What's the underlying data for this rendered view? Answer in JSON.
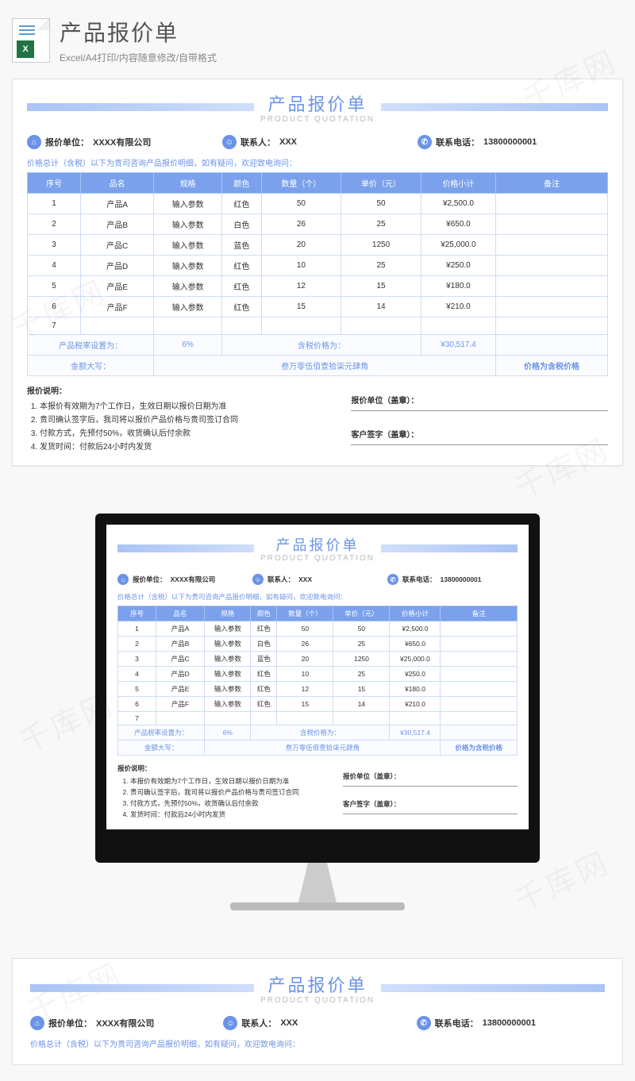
{
  "watermark": "千库网",
  "header": {
    "file_badge": "X",
    "title": "产品报价单",
    "subtitle": "Excel/A4打印/内容随意修改/自带格式"
  },
  "quotation": {
    "title": "产品报价单",
    "subtitle": "PRODUCT QUOTATION",
    "company_label": "报价单位：",
    "company_value": "XXXX有限公司",
    "contact_label": "联系人：",
    "contact_value": "XXX",
    "phone_label": "联系电话：",
    "phone_value": "13800000001",
    "notice": "价格总计（含税）以下为贵司咨询产品报价明细，如有疑问，欢迎致电询问：",
    "columns": {
      "seq": "序号",
      "name": "品名",
      "spec": "规格",
      "color": "颜色",
      "qty": "数量（个）",
      "price": "单价（元）",
      "subtotal": "价格小计",
      "remark": "备注"
    },
    "rows": [
      {
        "seq": "1",
        "name": "产品A",
        "spec": "输入参数",
        "color": "红色",
        "qty": "50",
        "price": "50",
        "subtotal": "¥2,500.0",
        "remark": ""
      },
      {
        "seq": "2",
        "name": "产品B",
        "spec": "输入参数",
        "color": "白色",
        "qty": "26",
        "price": "25",
        "subtotal": "¥650.0",
        "remark": ""
      },
      {
        "seq": "3",
        "name": "产品C",
        "spec": "输入参数",
        "color": "蓝色",
        "qty": "20",
        "price": "1250",
        "subtotal": "¥25,000.0",
        "remark": ""
      },
      {
        "seq": "4",
        "name": "产品D",
        "spec": "输入参数",
        "color": "红色",
        "qty": "10",
        "price": "25",
        "subtotal": "¥250.0",
        "remark": ""
      },
      {
        "seq": "5",
        "name": "产品E",
        "spec": "输入参数",
        "color": "红色",
        "qty": "12",
        "price": "15",
        "subtotal": "¥180.0",
        "remark": ""
      },
      {
        "seq": "6",
        "name": "产品F",
        "spec": "输入参数",
        "color": "红色",
        "qty": "15",
        "price": "14",
        "subtotal": "¥210.0",
        "remark": ""
      },
      {
        "seq": "7",
        "name": "",
        "spec": "",
        "color": "",
        "qty": "",
        "price": "",
        "subtotal": "",
        "remark": ""
      }
    ],
    "tax_label": "产品税率设置为：",
    "tax_value": "6%",
    "total_label": "含税价格为：",
    "total_value": "¥30,517.4",
    "amount_cn_label": "金额大写：",
    "amount_cn_value": "叁万零伍佰壹拾柒元肆角",
    "remark_note": "价格为含税价格",
    "footer": {
      "title": "报价说明：",
      "items": [
        "本报价有效期为7个工作日，生效日期以报价日期为准",
        "贵司确认签字后，我司将以报价产品价格与贵司签订合同",
        "付款方式，先预付50%，收货确认后付余款",
        "发货时间：付款后24小时内发货"
      ],
      "sig1": "报价单位（盖章）：",
      "sig2": "客户签字（盖章）："
    }
  }
}
